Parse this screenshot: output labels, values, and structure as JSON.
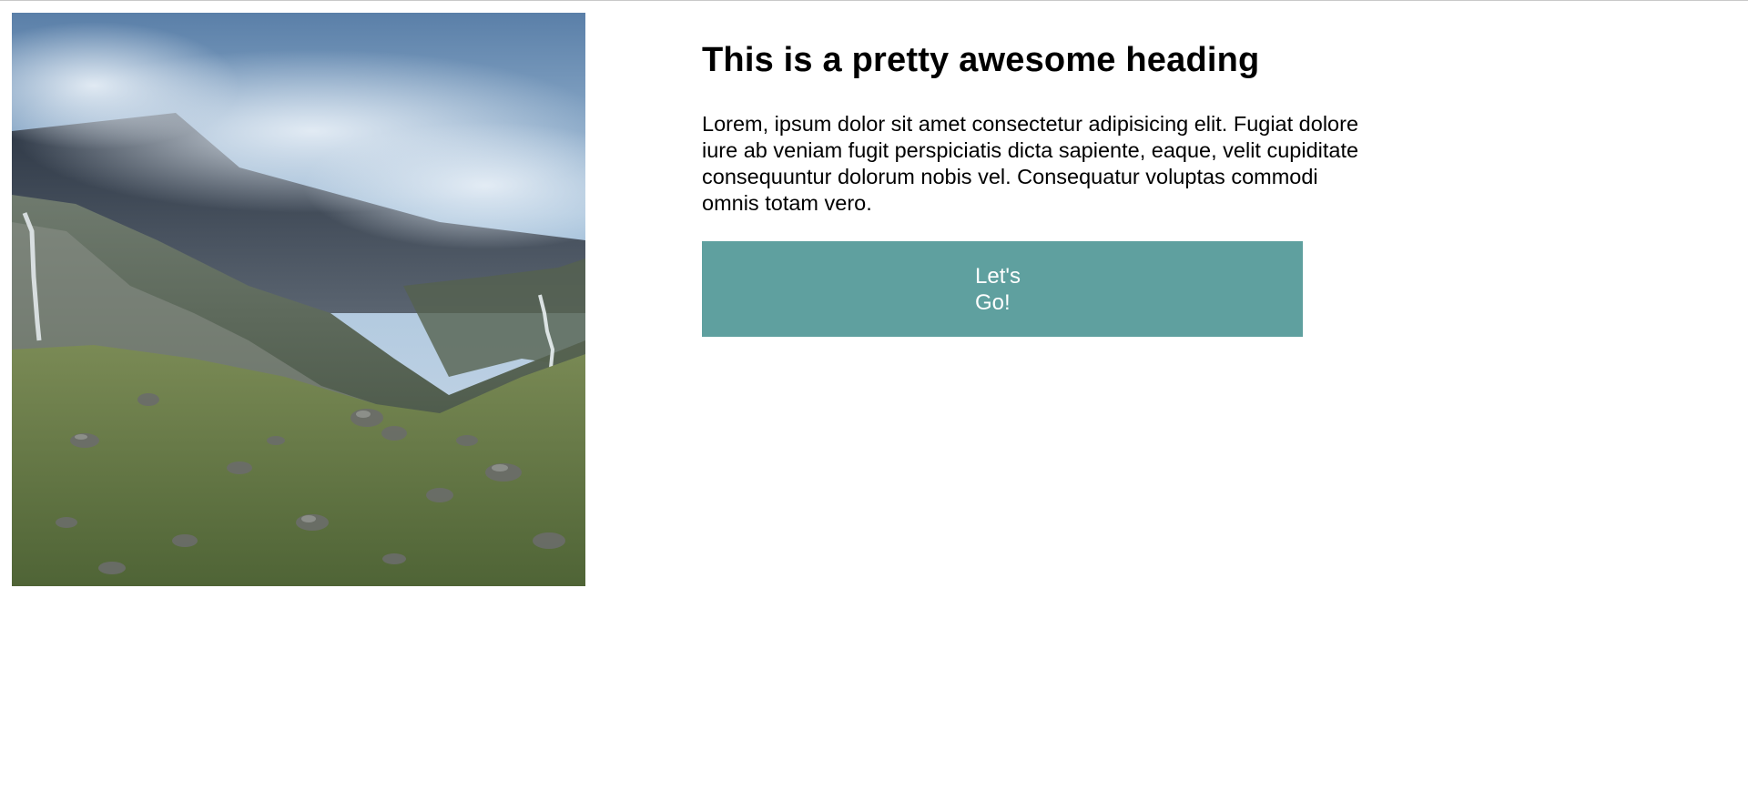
{
  "hero": {
    "alt": "Misty mountain valley with waterfalls and rocky green slopes"
  },
  "content": {
    "heading": "This is a pretty awesome heading",
    "paragraph": "Lorem, ipsum dolor sit amet consectetur adipisicing elit. Fugiat dolore iure ab veniam fugit perspiciatis dicta sapiente, eaque, velit cupiditate consequuntur dolorum nobis vel. Consequatur voluptas commodi omnis totam vero.",
    "button_label": "Let's Go!"
  },
  "colors": {
    "button_bg": "#5fa09f",
    "button_text": "#ffffff",
    "page_bg": "#ffffff"
  }
}
